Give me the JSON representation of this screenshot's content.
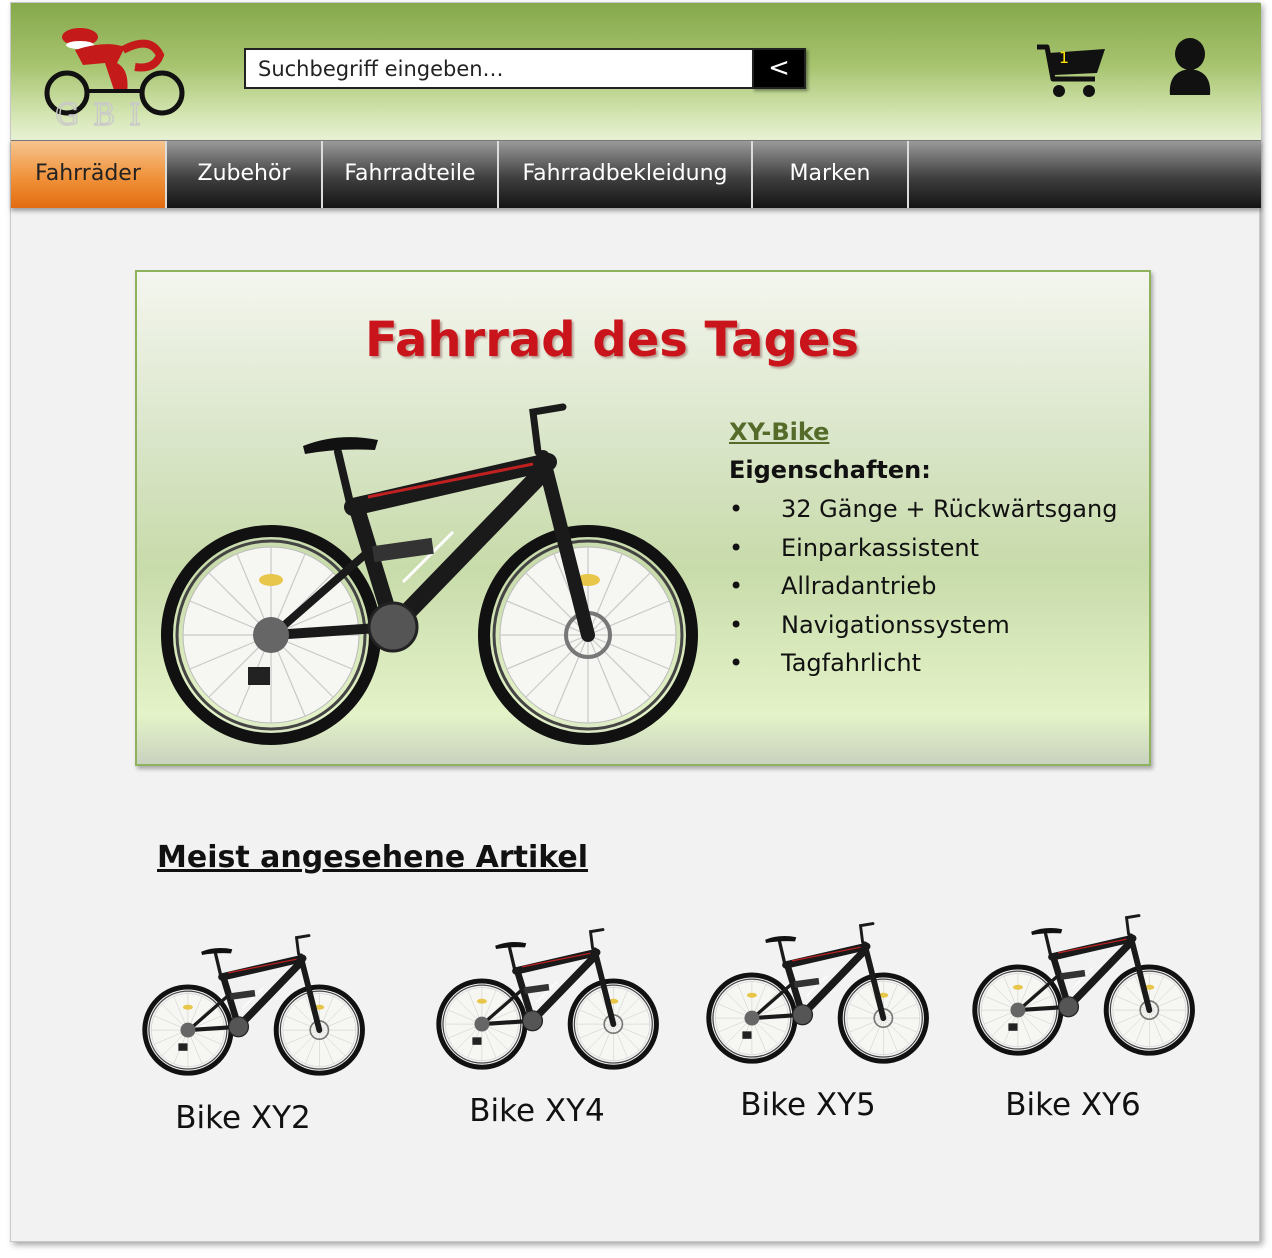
{
  "header": {
    "logo_text": "GBI",
    "search": {
      "placeholder": "Suchbegriff eingeben…",
      "button_label": "<"
    },
    "cart": {
      "count": "1"
    }
  },
  "nav": {
    "items": [
      {
        "label": "Fahrräder",
        "active": true
      },
      {
        "label": "Zubehör",
        "active": false
      },
      {
        "label": "Fahrradteile",
        "active": false
      },
      {
        "label": "Fahrradbekleidung",
        "active": false
      },
      {
        "label": "Marken",
        "active": false
      }
    ]
  },
  "featured": {
    "title": "Fahrrad des Tages",
    "product_name": "XY-Bike",
    "properties_label": "Eigenschaften:",
    "properties": [
      "32 Gänge + Rückwärtsgang",
      "Einparkassistent",
      "Allradantrieb",
      "Navigationssystem",
      "Tagfahrlicht"
    ]
  },
  "most_viewed": {
    "title": "Meist angesehene Artikel",
    "items": [
      {
        "label": "Bike XY2"
      },
      {
        "label": "Bike XY4"
      },
      {
        "label": "Bike XY5"
      },
      {
        "label": "Bike XY6"
      }
    ]
  },
  "colors": {
    "header_green": "#86a94c",
    "active_tab_orange": "#f0923a",
    "title_red": "#c8141a",
    "link_green": "#546b2a"
  }
}
